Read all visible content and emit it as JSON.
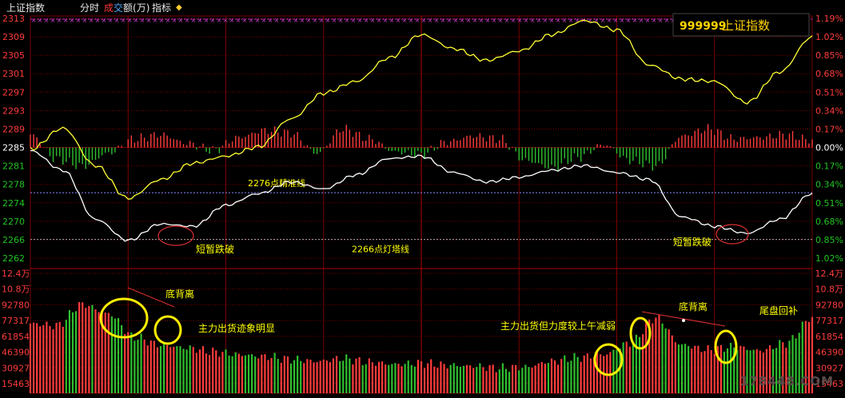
{
  "header": {
    "title": "上证指数",
    "tabs": [
      "分时",
      "成交额(万)",
      "指标"
    ],
    "tab_prefix_red": "成",
    "tab_prefix_blue": "交",
    "tab_suffix": "额(万)"
  },
  "info_box": {
    "code": "999999",
    "name": "上证指数"
  },
  "watermark": "178448.COM",
  "colors": {
    "up": "#ff3c3c",
    "down": "#2fbf2f",
    "index_line": "#ffffff",
    "avg_line": "#ffff33",
    "grid": "#7a0000",
    "axis_text_red": "#ff3c3c",
    "axis_text_green": "#22c322",
    "annotation": "#ffff00"
  },
  "chart_data": {
    "type": "line",
    "price_axis_left": [
      "2313",
      "2309",
      "2305",
      "2301",
      "2297",
      "2293",
      "2289",
      "2285",
      "2281",
      "2278",
      "2274",
      "2270",
      "2266",
      "2262"
    ],
    "pct_axis_right": [
      "1.19%",
      "1.02%",
      "0.85%",
      "0.68%",
      "0.51%",
      "0.34%",
      "0.17%",
      "0.00%",
      "0.17%",
      "0.34%",
      "0.51%",
      "0.68%",
      "0.85%",
      "1.02%"
    ],
    "pct_axis_right_color": [
      "red",
      "red",
      "red",
      "red",
      "red",
      "red",
      "red",
      "white",
      "green",
      "green",
      "green",
      "green",
      "green",
      "green"
    ],
    "volume_axis_left": [
      "12.4万",
      "10.8万",
      "92780",
      "77317",
      "61854",
      "46390",
      "30927",
      "15463"
    ],
    "volume_axis_right": [
      "12.4万",
      "10.8万",
      "92780",
      "77317",
      "61854",
      "46390",
      "30927",
      "15463"
    ],
    "prev_close": 2285,
    "ylim": [
      2261,
      2314
    ],
    "series": [
      {
        "x": [
          0,
          10,
          20,
          30,
          40,
          50,
          60,
          70,
          80,
          90,
          100,
          110,
          120,
          130,
          140,
          150,
          160,
          170,
          180,
          190,
          200,
          210,
          220,
          230,
          240
        ],
        "values": [
          2285.2,
          2281.0,
          2270.5,
          2266.0,
          2269.5,
          2269.0,
          2273.5,
          2276.0,
          2278.5,
          2277.0,
          2280.0,
          2283.5,
          2284.0,
          2280.5,
          2278.5,
          2279.5,
          2281.0,
          2282.0,
          2280.5,
          2279.0,
          2271.0,
          2269.0,
          2267.5,
          2270.5,
          2276.0
        ]
      },
      {
        "x": [
          0,
          10,
          20,
          30,
          40,
          50,
          60,
          70,
          80,
          90,
          100,
          110,
          120,
          130,
          140,
          150,
          160,
          170,
          180,
          190,
          200,
          210,
          220,
          230,
          240
        ],
        "values": [
          2285.5,
          2290.0,
          2282.0,
          2275.0,
          2279.0,
          2282.5,
          2284.0,
          2286.0,
          2292.0,
          2297.5,
          2300.0,
          2305.0,
          2310.0,
          2307.0,
          2304.5,
          2306.5,
          2310.0,
          2313.0,
          2311.0,
          2303.5,
          2300.5,
          2300.0,
          2295.5,
          2302.0,
          2309.5
        ]
      }
    ],
    "volume_ylim": [
      0,
      124000
    ],
    "volume_x": [
      0,
      8,
      16,
      24,
      32,
      40,
      48,
      56,
      64,
      72,
      80,
      88,
      96,
      104,
      112,
      120,
      128,
      136,
      144,
      152,
      160,
      168,
      176,
      184,
      192,
      200,
      208,
      216,
      224,
      232,
      240
    ],
    "volume": [
      72000,
      70000,
      92000,
      82000,
      58000,
      50000,
      47000,
      43000,
      40000,
      38000,
      35000,
      33000,
      36000,
      32000,
      30000,
      31000,
      29000,
      28000,
      26000,
      27000,
      33000,
      37000,
      40000,
      52000,
      78000,
      50000,
      45000,
      48000,
      44000,
      52000,
      78000
    ],
    "breadth_x": [
      0,
      8,
      16,
      24,
      32,
      40,
      48,
      56,
      64,
      72,
      80,
      88,
      96,
      104,
      112,
      120,
      128,
      136,
      144,
      152,
      160,
      168,
      176,
      184,
      192,
      200,
      208,
      216,
      224,
      232,
      240
    ],
    "breadth": [
      0.9,
      -0.8,
      -1.3,
      -0.4,
      0.6,
      0.9,
      0.3,
      -0.2,
      0.7,
      1.2,
      1.0,
      -0.4,
      1.3,
      0.6,
      -0.3,
      -0.5,
      0.4,
      0.8,
      0.6,
      -0.9,
      -1.4,
      -0.7,
      0.2,
      -0.9,
      -1.3,
      0.8,
      1.3,
      0.6,
      0.7,
      0.9,
      0.5
    ],
    "reference_lines": [
      {
        "label": "2276点精准线",
        "value": 2276.2,
        "color": "#8a8aff"
      },
      {
        "label": "2266点灯塔线",
        "value": 2266.2,
        "color": "#aaaaaa"
      }
    ],
    "annotations": [
      {
        "text": "短暂跌破",
        "target": "first-dip"
      },
      {
        "text": "短暂跌破",
        "target": "second-dip"
      },
      {
        "text": "底背离",
        "target": "volume-left"
      },
      {
        "text": "主力出货迹象明显",
        "target": "volume-left"
      },
      {
        "text": "主力出货但力度较上午减弱",
        "target": "volume-right"
      },
      {
        "text": "底背离",
        "target": "volume-right"
      },
      {
        "text": "尾盘回补",
        "target": "volume-end"
      }
    ],
    "grid": true
  }
}
